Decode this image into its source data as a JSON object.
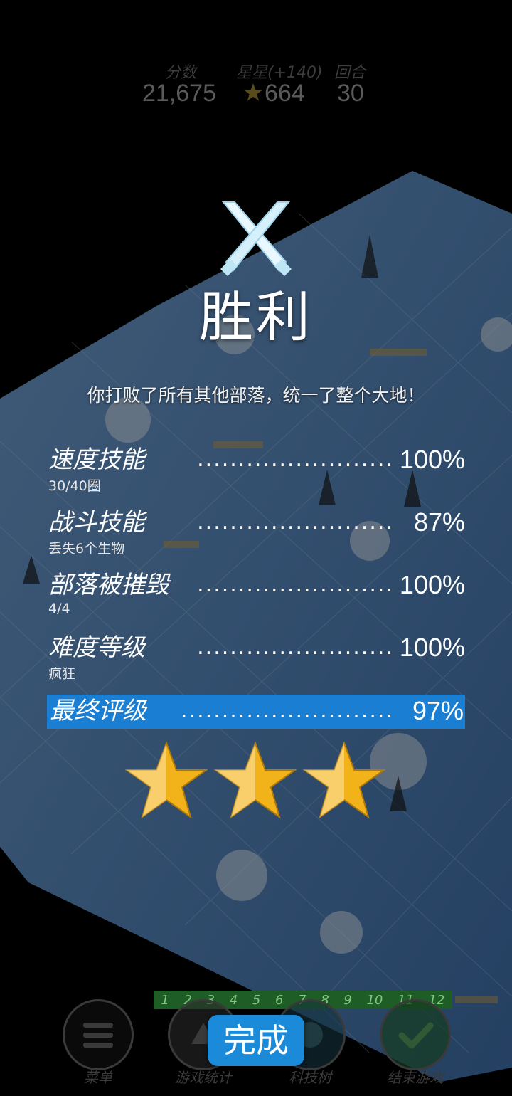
{
  "hud": {
    "score_label": "分数",
    "score_value": "21,675",
    "stars_label": "星星(+140)",
    "stars_value": "664",
    "turn_label": "回合",
    "turn_value": "30"
  },
  "victory": {
    "title": "胜利",
    "message": "你打败了所有其他部落，统一了整个大地！"
  },
  "stats": [
    {
      "name": "速度技能",
      "dots": "........................",
      "pct": "100%",
      "sub": "30/40圈"
    },
    {
      "name": "战斗技能",
      "dots": "........................",
      "pct": "87%",
      "sub": "丢失6个生物"
    },
    {
      "name": "部落被摧毁",
      "dots": "........................",
      "pct": "100%",
      "sub": "4/4"
    },
    {
      "name": "难度等级",
      "dots": "........................",
      "pct": "100%",
      "sub": "疯狂"
    }
  ],
  "final": {
    "name": "最终评级",
    "dots": "..........................",
    "pct": "97%"
  },
  "star_rating": {
    "earned": 3,
    "max": 3
  },
  "turn_numbers": [
    "1",
    "2",
    "3",
    "4",
    "5",
    "6",
    "7",
    "8",
    "9",
    "10",
    "11",
    "12"
  ],
  "nav": {
    "menu": "菜单",
    "stats": "游戏统计",
    "tech": "科技树",
    "end": "结束游戏"
  },
  "done_button": "完成",
  "colors": {
    "accent_blue": "#1a7fd3",
    "star_gold": "#f2b21a",
    "map_ice": "#6fa0cc"
  }
}
